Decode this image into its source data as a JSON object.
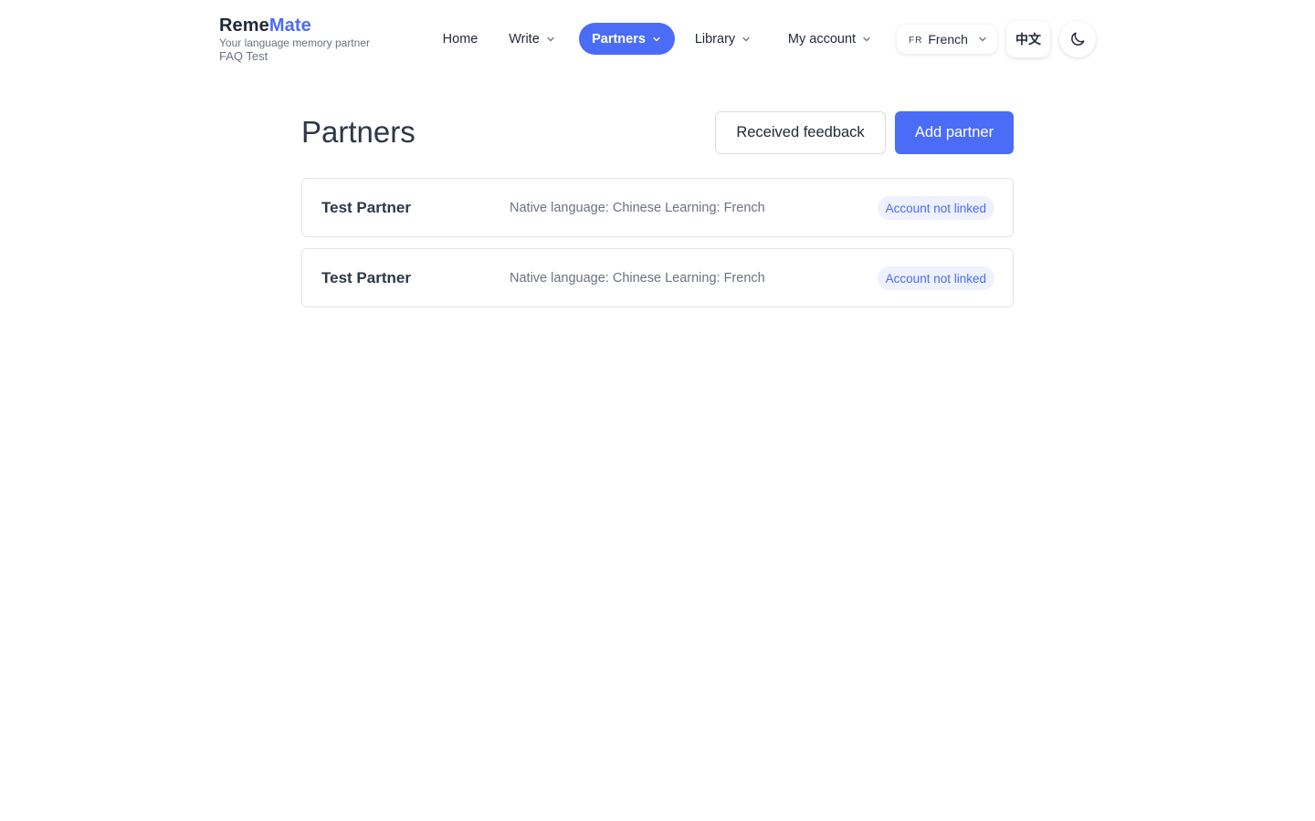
{
  "brand": {
    "name_part1": "Reme",
    "name_part2": "Mate",
    "tagline": "Your language memory partner",
    "subtitle": "FAQ Test"
  },
  "nav": {
    "items": [
      {
        "label": "Home",
        "has_dropdown": false,
        "active": false
      },
      {
        "label": "Write",
        "has_dropdown": true,
        "active": false
      },
      {
        "label": "Partners",
        "has_dropdown": true,
        "active": true
      },
      {
        "label": "Library",
        "has_dropdown": true,
        "active": false
      },
      {
        "label": "My account",
        "has_dropdown": true,
        "active": false
      }
    ]
  },
  "language_select": {
    "code": "FR",
    "label": "French"
  },
  "ui_language_button": "中文",
  "theme_toggle_icon": "moon-icon",
  "page": {
    "title": "Partners",
    "received_feedback_label": "Received feedback",
    "add_partner_label": "Add partner"
  },
  "partners": [
    {
      "name": "Test Partner",
      "meta": "Native language: Chinese Learning: French",
      "status": "Account not linked"
    },
    {
      "name": "Test Partner",
      "meta": "Native language: Chinese Learning: French",
      "status": "Account not linked"
    }
  ],
  "colors": {
    "accent": "#4a6cf7",
    "badge_bg": "#eef1fe",
    "text": "#1f2937",
    "muted": "#6b7280",
    "border": "#e3e6ea"
  }
}
